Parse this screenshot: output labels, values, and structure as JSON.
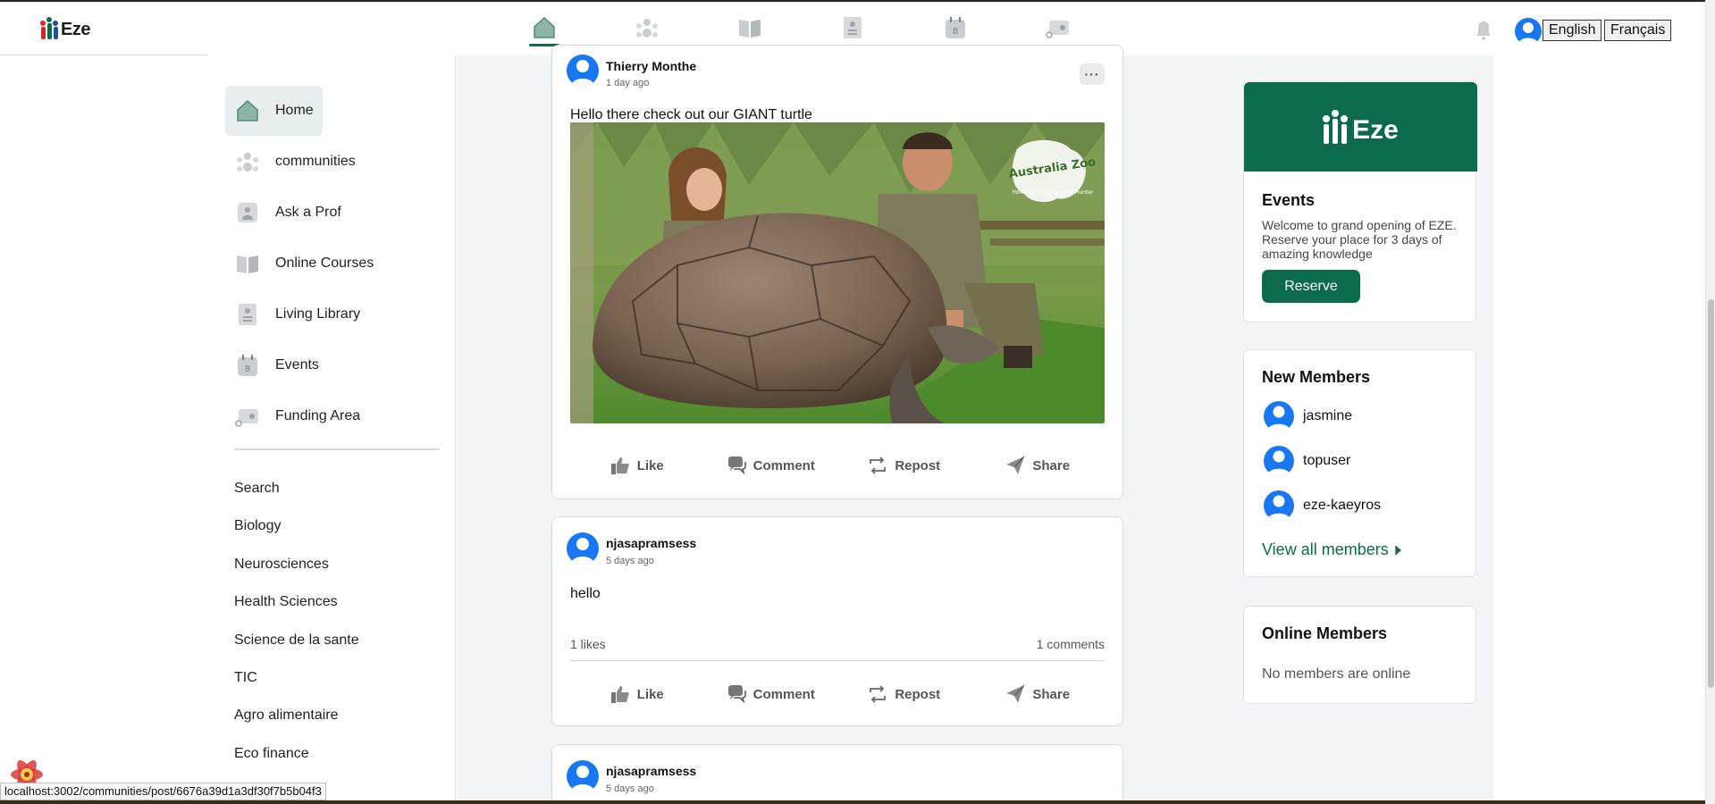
{
  "topbar": {
    "logo_text": "Eze",
    "nav_icons": [
      "home-icon",
      "communities-icon",
      "online-courses-icon",
      "living-library-icon",
      "events-icon",
      "funding-area-icon"
    ],
    "lang_english": "English",
    "lang_french": "Français"
  },
  "sidebar": {
    "items": [
      {
        "label": "Home",
        "icon": "home-icon"
      },
      {
        "label": "communities",
        "icon": "communities-icon"
      },
      {
        "label": "Ask a Prof",
        "icon": "ask-a-prof-icon"
      },
      {
        "label": "Online Courses",
        "icon": "online-courses-icon"
      },
      {
        "label": "Living Library",
        "icon": "living-library-icon"
      },
      {
        "label": "Events",
        "icon": "events-icon"
      },
      {
        "label": "Funding Area",
        "icon": "funding-area-icon"
      }
    ],
    "categories": [
      "Search",
      "Biology",
      "Neurosciences",
      "Health Sciences",
      "Science de la sante",
      "TIC",
      "Agro alimentaire",
      "Eco finance"
    ],
    "events_calendar_day": "8"
  },
  "feed": {
    "posts": [
      {
        "author": "Thierry Monthe",
        "time": "1 day ago",
        "text": "Hello there check out our GIANT turtle",
        "more_label": "···",
        "image_caption": "Australia Zoo",
        "image_subcaption": "Home of The Crocodile Hunter"
      },
      {
        "author": "njasapramsess",
        "time": "5 days ago",
        "text": "hello",
        "likes": "1 likes",
        "comments": "1 comments"
      },
      {
        "author": "njasapramsess",
        "time": "5 days ago"
      }
    ],
    "actions": {
      "like": "Like",
      "comment": "Comment",
      "repost": "Repost",
      "share": "Share"
    }
  },
  "right": {
    "events": {
      "logo_text": "Eze",
      "title": "Events",
      "description": "Welcome to grand opening of EZE. Reserve your place for 3 days of amazing knowledge",
      "button": "Reserve"
    },
    "new_members": {
      "title": "New Members",
      "members": [
        "jasmine",
        "topuser",
        "eze-kaeyros"
      ],
      "view_all": "View all members"
    },
    "online_members": {
      "title": "Online Members",
      "empty": "No members are online"
    }
  },
  "statusbar": {
    "url": "localhost:3002/communities/post/6676a39d1a3df30f7b5b04f3"
  },
  "colors": {
    "brand_green": "#0c6b4f",
    "avatar_blue": "#1877f2",
    "icon_gray": "#c9ccd1"
  }
}
